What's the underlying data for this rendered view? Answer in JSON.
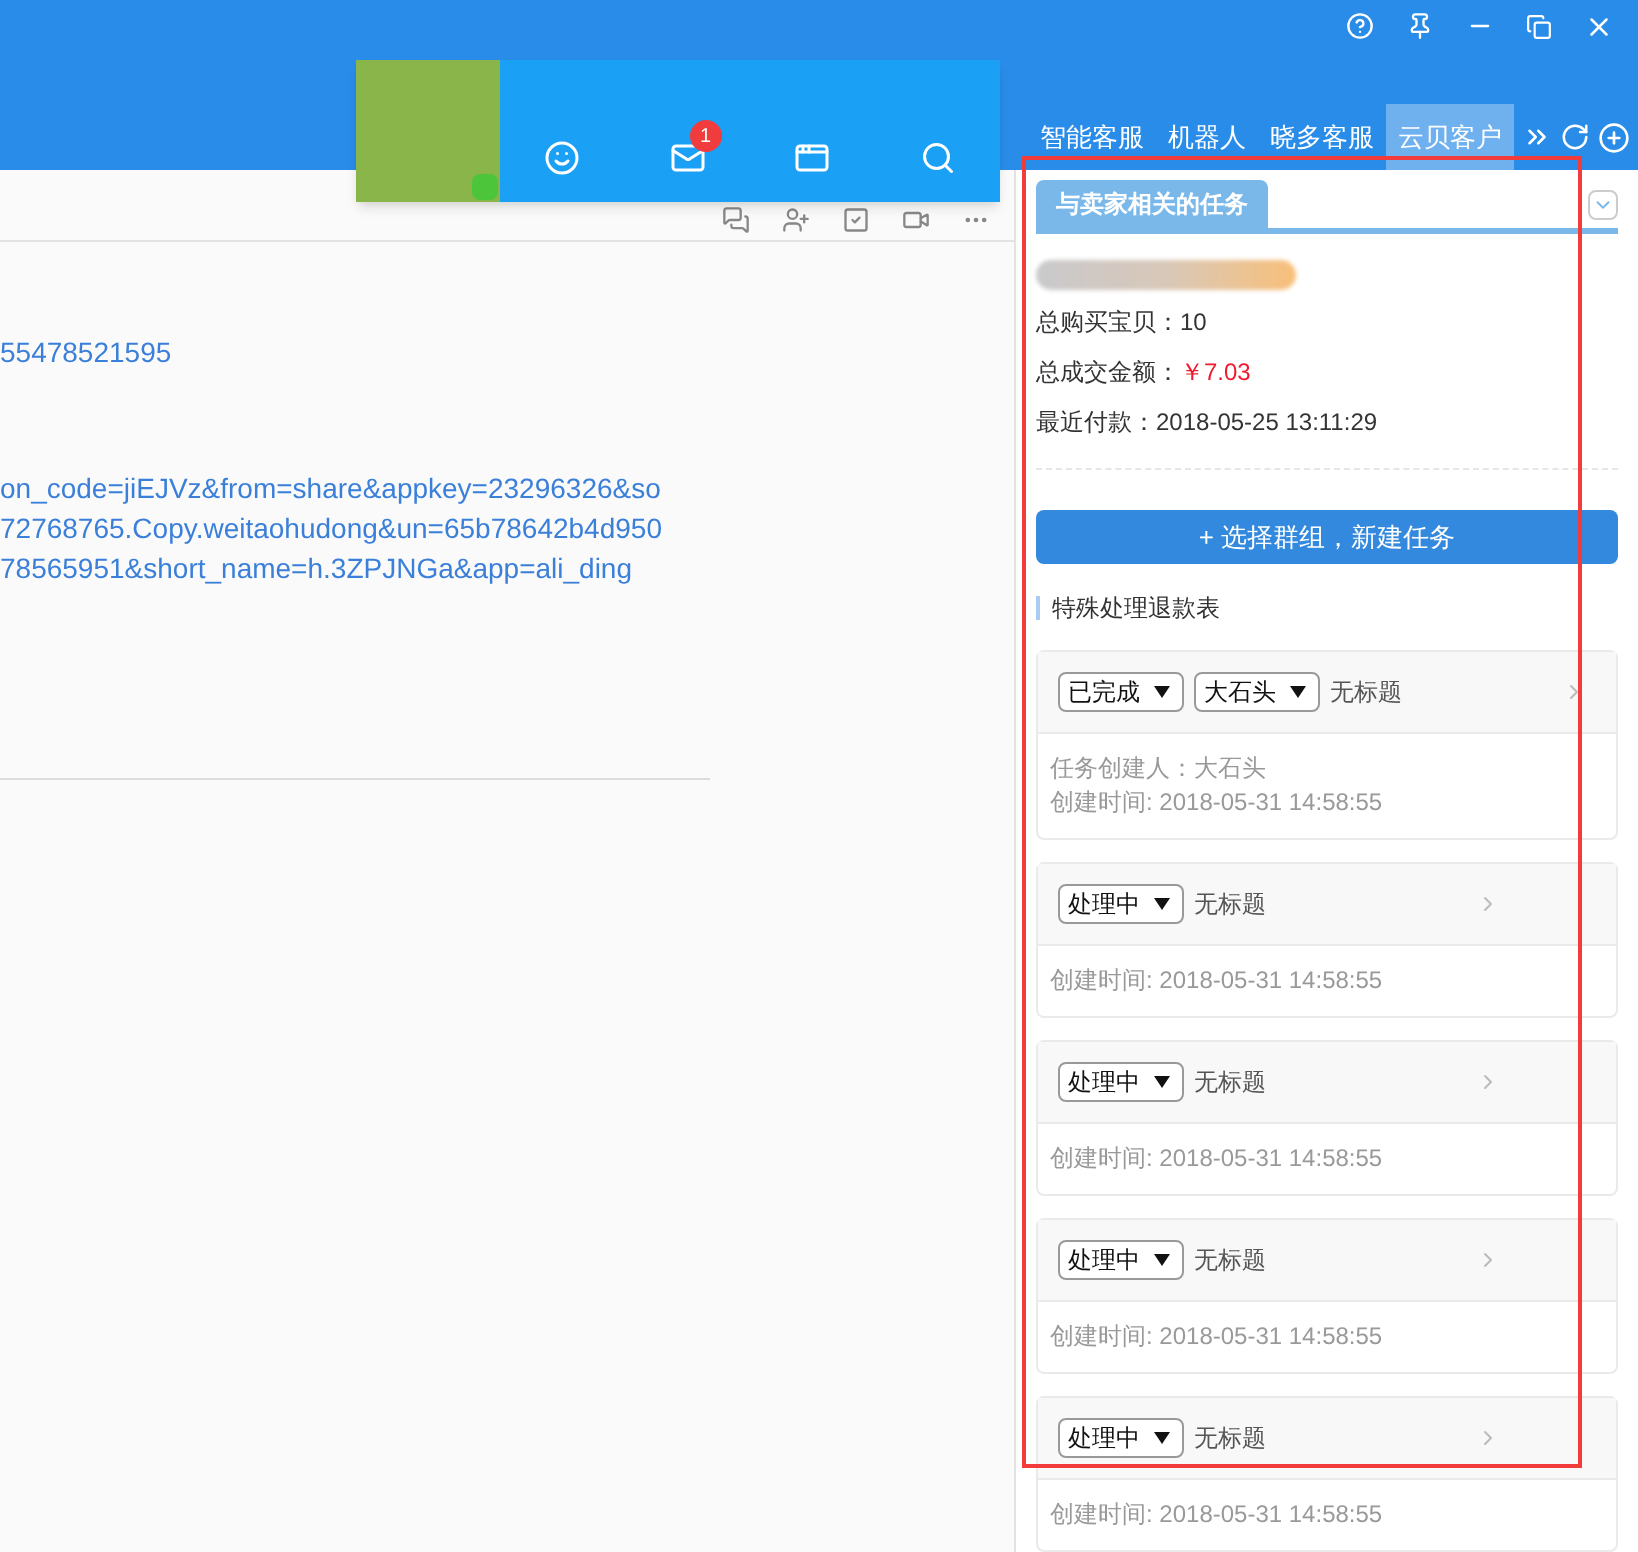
{
  "nav_tabs": [
    {
      "label": "智能客服",
      "selected": false
    },
    {
      "label": "机器人",
      "selected": false
    },
    {
      "label": "晓多客服",
      "selected": false
    },
    {
      "label": "云贝客户",
      "selected": true
    }
  ],
  "profile_card": {
    "unread_mail": "1"
  },
  "chat": {
    "lines": [
      "55478521595",
      "on_code=jiEJVz&from=share&appkey=23296326&so",
      "72768765.Copy.weitaohudong&un=65b78642b4d950",
      "78565951&short_name=h.3ZPJNGa&app=ali_ding"
    ]
  },
  "panel": {
    "tab": "与卖家相关的任务",
    "stats": [
      {
        "label": "总购买宝贝：",
        "value": "10",
        "highlight": false
      },
      {
        "label": "总成交金额：",
        "value": "￥7.03",
        "highlight": true
      },
      {
        "label": "最近付款：",
        "value": "2018-05-25 13:11:29",
        "highlight": false
      }
    ],
    "new_task_button": "+ 选择群组，新建任务",
    "section_title": "特殊处理退款表",
    "tasks": [
      {
        "selects": [
          "已完成",
          "大石头"
        ],
        "title": "无标题",
        "details": [
          "任务创建人：大石头",
          "创建时间: 2018-05-31 14:58:55"
        ]
      },
      {
        "selects": [
          "处理中"
        ],
        "title": "无标题",
        "details": [
          "创建时间: 2018-05-31 14:58:55"
        ]
      },
      {
        "selects": [
          "处理中"
        ],
        "title": "无标题",
        "details": [
          "创建时间: 2018-05-31 14:58:55"
        ]
      },
      {
        "selects": [
          "处理中"
        ],
        "title": "无标题",
        "details": [
          "创建时间: 2018-05-31 14:58:55"
        ]
      },
      {
        "selects": [
          "处理中"
        ],
        "title": "无标题",
        "details": [
          "创建时间: 2018-05-31 14:58:55"
        ]
      }
    ]
  }
}
